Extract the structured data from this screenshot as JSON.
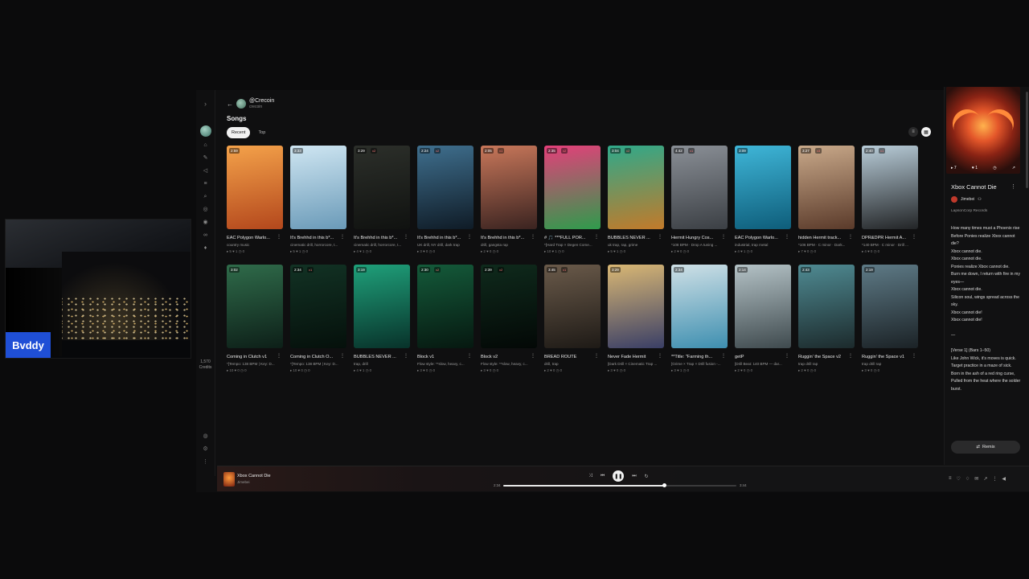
{
  "webcam": {
    "badge": "Bvddy"
  },
  "rail": {
    "credits_value": "1,570",
    "credits_label": "Credits"
  },
  "profile": {
    "name": "@Crecoin",
    "handle": "crecoin"
  },
  "songs_title": "Songs",
  "tabs": [
    {
      "label": "Recent",
      "active": true
    },
    {
      "label": "Top",
      "active": false
    }
  ],
  "cards": [
    {
      "duration": "2:59",
      "title": "EAC Polygon Warlo...",
      "genre": "country music",
      "stats": "▸ 5 ♥ 1 ◷ 0",
      "colors": [
        "#f4a24a",
        "#b3471c"
      ]
    },
    {
      "duration": "3:33",
      "title": "It's Brehhd in this b*...",
      "genre": "cinematic drill, horrorcore, t...",
      "stats": "▸ 5 ♥ 1 ◷ 0",
      "colors": [
        "#cfe6f2",
        "#6a9ab8"
      ]
    },
    {
      "duration": "3:29",
      "version": "v2",
      "title": "It's Brehhd in this b*...",
      "genre": "cinematic drill, horrorcore, t...",
      "stats": "▸ 4 ♥ 1 ◷ 0",
      "colors": [
        "#2c2f2a",
        "#101210"
      ]
    },
    {
      "duration": "2:24",
      "version": "v2",
      "title": "It's Brehhd in this b*...",
      "genre": "UK drill, NY drill, dark trap",
      "stats": "▸ 3 ♥ 0 ◷ 0",
      "colors": [
        "#3f6f8e",
        "#0f1b26"
      ]
    },
    {
      "duration": "2:05",
      "version": "v1",
      "title": "It's Brehhd in this b*...",
      "genre": "drill, gangsta rap",
      "stats": "▸ 2 ♥ 0 ◷ 0",
      "colors": [
        "#c8775a",
        "#3a2320"
      ]
    },
    {
      "duration": "2:35",
      "version": "v2",
      "title": "# 🎵 ***FULL POR...",
      "genre": "*[Hard Trap × Degen Come...",
      "stats": "▸ 10 ♥ 1 ◷ 0",
      "colors": [
        "#e43f7a",
        "#2f9b4c"
      ]
    },
    {
      "duration": "3:04",
      "version": "v2",
      "title": "BUBBLES NEVER ...",
      "genre": "uk trap, rap, grime",
      "stats": "▸ 5 ♥ 1 ◷ 0",
      "colors": [
        "#2fa98a",
        "#c27a2a"
      ]
    },
    {
      "duration": "4:42",
      "version": "v1",
      "title": "Hermit Hungry Cos...",
      "genre": "*108 BPM · Drop A tuning ...",
      "stats": "▸ 2 ♥ 0 ◷ 0",
      "colors": [
        "#8a8f96",
        "#3b3f44"
      ]
    },
    {
      "duration": "3:09",
      "title": "EAC Polygon Warlo...",
      "genre": "industrial, trap metal",
      "stats": "▸ 4 ♥ 1 ◷ 0",
      "colors": [
        "#3fb6d8",
        "#0e5d7a"
      ]
    },
    {
      "duration": "3:27",
      "version": "v3",
      "title": "hidden Hermit track...",
      "genre": "*106 BPM · C minor · Dark...",
      "stats": "▸ 7 ♥ 0 ◷ 0",
      "colors": [
        "#c9a98a",
        "#5a3a2a"
      ]
    },
    {
      "duration": "2:40",
      "version": "v1",
      "title": "DPR&DPR Hermit A...",
      "genre": "*140 BPM · C minor · Drill ...",
      "stats": "▸ 4 ♥ 0 ◷ 0",
      "colors": [
        "#b8ccd8",
        "#222426"
      ]
    },
    {
      "duration": "3:02",
      "title": "Coming in Clutch v1",
      "genre": "*[Tempo: 138 BPM | Key: D...",
      "stats": "▸ 10 ♥ 0 ◷ 0",
      "colors": [
        "#2f6b4a",
        "#0d1f18"
      ]
    },
    {
      "duration": "2:34",
      "version": "v1",
      "title": "Coming in Clutch O...",
      "genre": "*[Tempo: 138 BPM | Key: D...",
      "stats": "▸ 10 ♥ 0 ◷ 0",
      "colors": [
        "#123224",
        "#05100b"
      ]
    },
    {
      "duration": "3:19",
      "title": "BUBBLES NEVER ...",
      "genre": "trap, drill",
      "stats": "▸ 4 ♥ 1 ◷ 0",
      "colors": [
        "#1fa07a",
        "#08322a"
      ]
    },
    {
      "duration": "2:30",
      "version": "v2",
      "title": "Block v1",
      "genre": "Flow style: **slow, heavy, c...",
      "stats": "▸ 3 ♥ 0 ◷ 0",
      "colors": [
        "#145a3a",
        "#061810"
      ]
    },
    {
      "duration": "2:39",
      "version": "v2",
      "title": "Block v2",
      "genre": "Flow style: **slow, heavy, c...",
      "stats": "▸ 3 ♥ 0 ◷ 0",
      "colors": [
        "#0f2a1c",
        "#030806"
      ]
    },
    {
      "duration": "3:45",
      "version": "v1",
      "title": "BREAD ROUTE",
      "genre": "drill, trap",
      "stats": "▸ 2 ♥ 0 ◷ 0",
      "colors": [
        "#6a5a4a",
        "#1e1a16"
      ]
    },
    {
      "duration": "3:29",
      "title": "Never Fade Hermit",
      "genre": "[Dark Drill × Cinematic Trap ...",
      "stats": "▸ 3 ♥ 0 ◷ 0",
      "colors": [
        "#d9b774",
        "#3a3f66"
      ]
    },
    {
      "duration": "2:34",
      "title": "**Title: \"Farming th...",
      "genre": "[Grime × Trap × Drill fusion -...",
      "stats": "▸ 3 ♥ 1 ◷ 0",
      "colors": [
        "#cfe0e6",
        "#3e8fb0"
      ]
    },
    {
      "duration": "2:14",
      "title": "getP",
      "genre": "[Drill Beat: 140 BPM — dar...",
      "stats": "▸ 2 ♥ 0 ◷ 0",
      "colors": [
        "#b4c2c6",
        "#3f4a4e"
      ]
    },
    {
      "duration": "2:43",
      "title": "Ruggin' the Space v2",
      "genre": "trap drill rap",
      "stats": "▸ 2 ♥ 0 ◷ 0",
      "colors": [
        "#4f8a92",
        "#1c2a2c"
      ]
    },
    {
      "duration": "2:19",
      "title": "Ruggin' the Space v1",
      "genre": "trap drill rap",
      "stats": "▸ 3 ♥ 0 ◷ 0",
      "colors": [
        "#5e7a86",
        "#1b2226"
      ]
    }
  ],
  "panel": {
    "song_title": "Xbox Cannot Die",
    "artist": "Jimebei",
    "label": "LapsonCorp Records",
    "art_stats": [
      "▸ 7",
      "♥ 1",
      "◷",
      "↗"
    ],
    "lyrics": "How many times must a Phoenix rise\nBefore Ponies realize Xbox cannot die?\nXbox cannot die.\nXbox cannot die.\nPonies realize Xbox cannot die.\nBurn me down, I return with fire in my eyes—\nXbox cannot die.\nSilicon soul, wings spread across the sky.\nXbox cannot die!\nXbox cannot die!\n\n—\n\n[Verse 1] (Bars 1–50)\nLike John Wick, it's moves is quick.\nTarget practice in a maze of sick.\nBorn in the ash of a red ring curse,\nPulled from the heat where the solder burst.",
    "remix_label": "Remix"
  },
  "player": {
    "title": "Xbox Cannot Die",
    "artist": "Jimebei",
    "time_current": "2:34",
    "time_total": "3:44",
    "progress": 0.69
  },
  "colors": {
    "accent": "#f1f1f1",
    "badge": "#1f4fd6",
    "version_badge": "#ff7a7a"
  }
}
